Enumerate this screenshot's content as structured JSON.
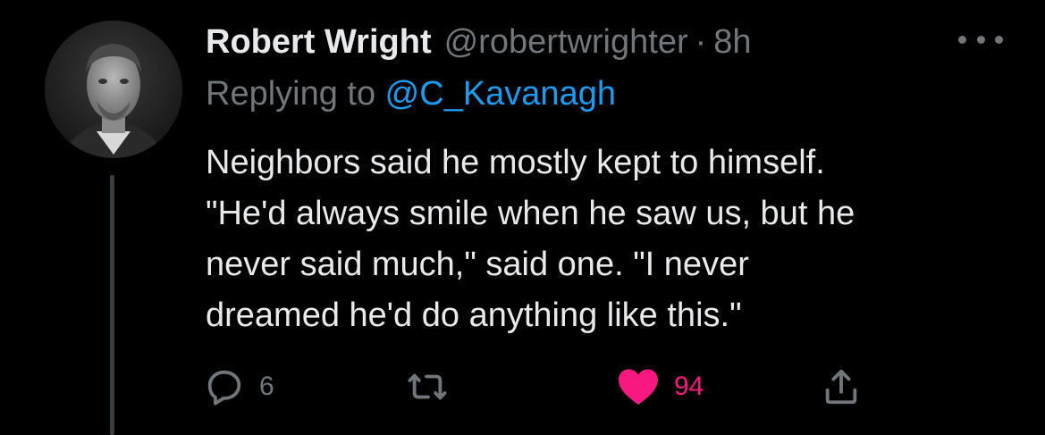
{
  "tweet": {
    "display_name": "Robert Wright",
    "handle": "@robertwrighter",
    "separator": "·",
    "time": "8h",
    "replying_prefix": "Replying to ",
    "replying_to": "@C_Kavanagh",
    "text": "Neighbors said he mostly kept to himself.\n\"He'd always smile when he saw us, but he\nnever said much,\" said one. \"I never\ndreamed he'd do anything like this.\"",
    "avatar": "profile-photo-icon"
  },
  "actions": {
    "reply": {
      "icon": "reply-icon",
      "count": "6"
    },
    "retweet": {
      "icon": "retweet-icon",
      "count": ""
    },
    "like": {
      "icon": "heart-icon",
      "count": "94",
      "liked": true
    },
    "share": {
      "icon": "share-icon"
    }
  },
  "colors": {
    "background": "#000000",
    "text": "#e7e9ea",
    "secondary": "#71767b",
    "mention": "#1d9bf0",
    "like": "#f91880"
  }
}
